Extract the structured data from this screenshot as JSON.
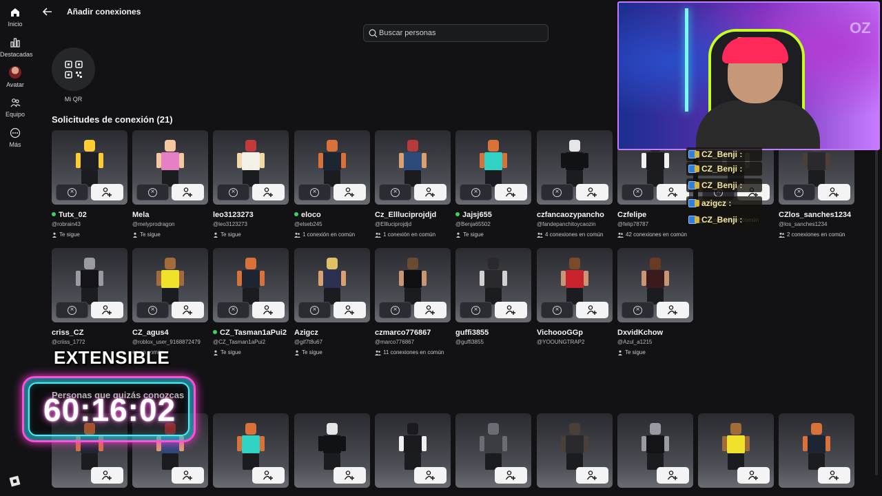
{
  "sidebar": {
    "items": [
      {
        "label": "Inicio",
        "icon": "home-icon"
      },
      {
        "label": "Destacadas",
        "icon": "charts-icon"
      },
      {
        "label": "Avatar",
        "icon": "avatar-icon"
      },
      {
        "label": "Equipo",
        "icon": "team-icon"
      },
      {
        "label": "Más",
        "icon": "more-icon"
      }
    ]
  },
  "header": {
    "title": "Añadir conexiones",
    "back_icon": "back-arrow-icon"
  },
  "search": {
    "placeholder": "Buscar personas"
  },
  "qr": {
    "label": "Mi QR"
  },
  "requests": {
    "title": "Solicitudes de conexión (21)",
    "cards": [
      {
        "name": "Tutx_02",
        "handle": "@robrain43",
        "meta": "Te sigue",
        "meta_icon": "person",
        "online": true
      },
      {
        "name": "Mela",
        "handle": "@melyprodragon",
        "meta": "Te sigue",
        "meta_icon": "person",
        "online": false
      },
      {
        "name": "leo3123273",
        "handle": "@leo3123273",
        "meta": "Te sigue",
        "meta_icon": "person",
        "online": false
      },
      {
        "name": "eloco",
        "handle": "@elseb245",
        "meta": "1 conexión en común",
        "meta_icon": "group",
        "online": true
      },
      {
        "name": "Cz_Ellluciprojdjd",
        "handle": "@Ellluciprojdjd",
        "meta": "1 conexión en común",
        "meta_icon": "group",
        "online": false
      },
      {
        "name": "Jajsj655",
        "handle": "@Benja65502",
        "meta": "Te sigue",
        "meta_icon": "person",
        "online": true
      },
      {
        "name": "czfancaozypancho",
        "handle": "@fandepanchitoycaozin",
        "meta": "4 conexiones en común",
        "meta_icon": "group",
        "online": false
      },
      {
        "name": "Czfelipe",
        "handle": "@felip78787",
        "meta": "42 conexiones en común",
        "meta_icon": "group",
        "online": false
      },
      {
        "name": "",
        "handle": "",
        "meta": "1 conexión en común",
        "meta_icon": "group",
        "online": false
      },
      {
        "name": "CZlos_sanches1234",
        "handle": "@los_sanches1234",
        "meta": "2 conexiones en común",
        "meta_icon": "group",
        "online": false
      },
      {
        "name": "criss_CZ",
        "handle": "@criiss_1772",
        "meta": "",
        "meta_icon": "",
        "online": false
      },
      {
        "name": "CZ_agus4",
        "handle": "@roblox_user_9168872479",
        "meta": "es en común",
        "meta_icon": "",
        "online": false
      },
      {
        "name": "CZ_Tasman1aPui2",
        "handle": "@CZ_Tasman1aPui2",
        "meta": "Te sigue",
        "meta_icon": "person",
        "online": true
      },
      {
        "name": "Azigcz",
        "handle": "@gif7t8u67",
        "meta": "Te sigue",
        "meta_icon": "person",
        "online": false
      },
      {
        "name": "czmarco776867",
        "handle": "@marco776867",
        "meta": "11 conexiones en común",
        "meta_icon": "group",
        "online": false
      },
      {
        "name": "guffi3855",
        "handle": "@guffi3855",
        "meta": "",
        "meta_icon": "",
        "online": false
      },
      {
        "name": "VichoooGGp",
        "handle": "@YOOUNGTRAP2",
        "meta": "",
        "meta_icon": "",
        "online": false
      },
      {
        "name": "DxvidKchow",
        "handle": "@Azul_a1215",
        "meta": "Te sigue",
        "meta_icon": "person",
        "online": false
      }
    ]
  },
  "suggestions": {
    "title": "Personas que quizás conozcas",
    "cards": [
      {
        "name": ""
      },
      {
        "name": ""
      },
      {
        "name": ""
      },
      {
        "name": ""
      },
      {
        "name": ""
      },
      {
        "name": ""
      },
      {
        "name": ""
      },
      {
        "name": ""
      },
      {
        "name": ""
      },
      {
        "name": ""
      }
    ]
  },
  "overlay": {
    "extensible": "EXTENSIBLE",
    "timer": "60:16:02",
    "chat": [
      {
        "text": "CZ_Benji :"
      },
      {
        "text": "CZ_Benji :"
      },
      {
        "text": "CZ_Benji :"
      },
      {
        "text": "azigcz :"
      },
      {
        "text": "CZ_Benji :"
      }
    ],
    "webcam_tag": "OZ"
  },
  "colors": {
    "background": "#121215",
    "card": "#3a3b41",
    "online": "#3fcf64",
    "accent_pink": "#ff4fd8",
    "accent_cyan": "#45f0ff"
  }
}
